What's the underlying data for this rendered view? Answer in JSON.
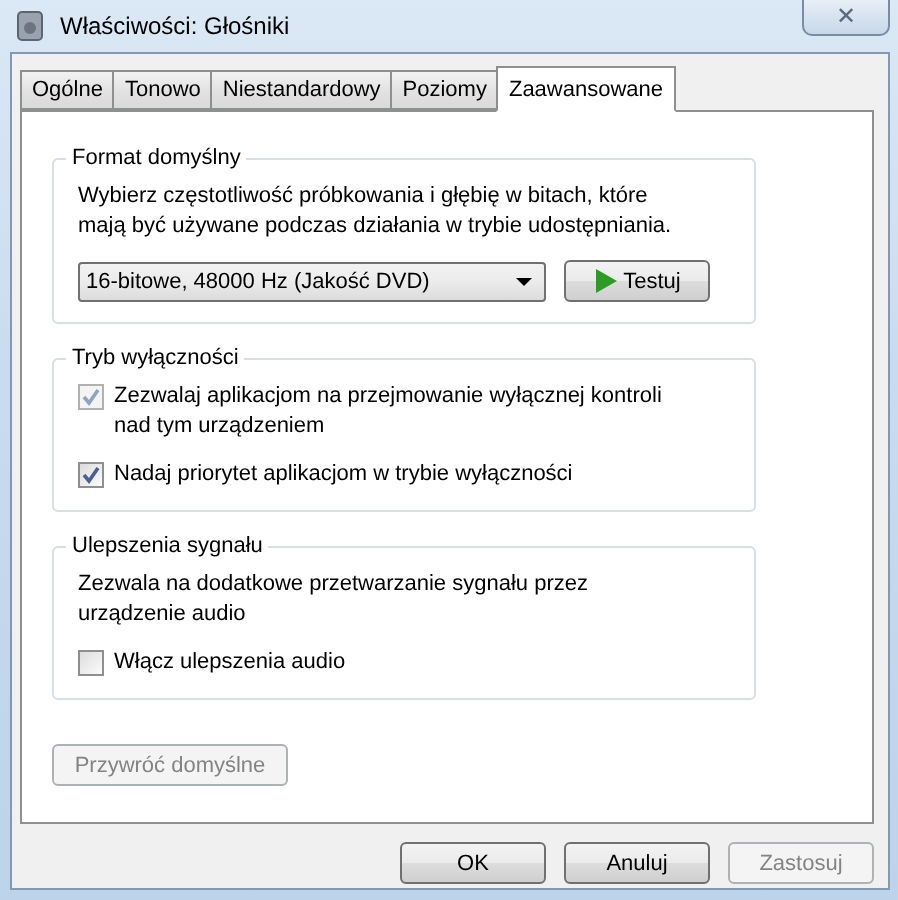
{
  "window": {
    "title": "Właściwości: Głośniki",
    "close": "✕"
  },
  "tabs": [
    {
      "label": "Ogólne",
      "selected": false
    },
    {
      "label": "Tonowo",
      "selected": false
    },
    {
      "label": "Niestandardowy",
      "selected": false
    },
    {
      "label": "Poziomy",
      "selected": false
    },
    {
      "label": "Zaawansowane",
      "selected": true
    }
  ],
  "groups": [
    {
      "title": "Format domyślny",
      "items": [
        {
          "kind": "text",
          "text": "Wybierz częstotliwość próbkowania i głębię w bitach, które mają być używane podczas działania w trybie udostępniania."
        },
        {
          "kind": "format",
          "value": "16-bitowe, 48000 Hz (Jakość DVD)",
          "button": "Testuj"
        }
      ]
    },
    {
      "title": "Tryb wyłączności",
      "items": [
        {
          "kind": "checkbox",
          "label": "Zezwalaj aplikacjom na przejmowanie wyłącznej kontroli nad tym urządzeniem",
          "checked": true,
          "disabled": true
        },
        {
          "kind": "checkbox",
          "label": "Nadaj priorytet aplikacjom w trybie wyłączności",
          "checked": true,
          "disabled": false
        }
      ]
    },
    {
      "title": "Ulepszenia sygnału",
      "items": [
        {
          "kind": "text",
          "text": "Zezwala na dodatkowe przetwarzanie sygnału przez urządzenie audio"
        },
        {
          "kind": "checkbox",
          "label": "Włącz ulepszenia audio",
          "checked": false,
          "disabled": false
        }
      ]
    }
  ],
  "restore_button": {
    "label": "Przywróć domyślne",
    "disabled": true
  },
  "buttons": [
    {
      "label": "OK",
      "disabled": false
    },
    {
      "label": "Anuluj",
      "disabled": false
    },
    {
      "label": "Zastosuj",
      "disabled": true
    }
  ]
}
